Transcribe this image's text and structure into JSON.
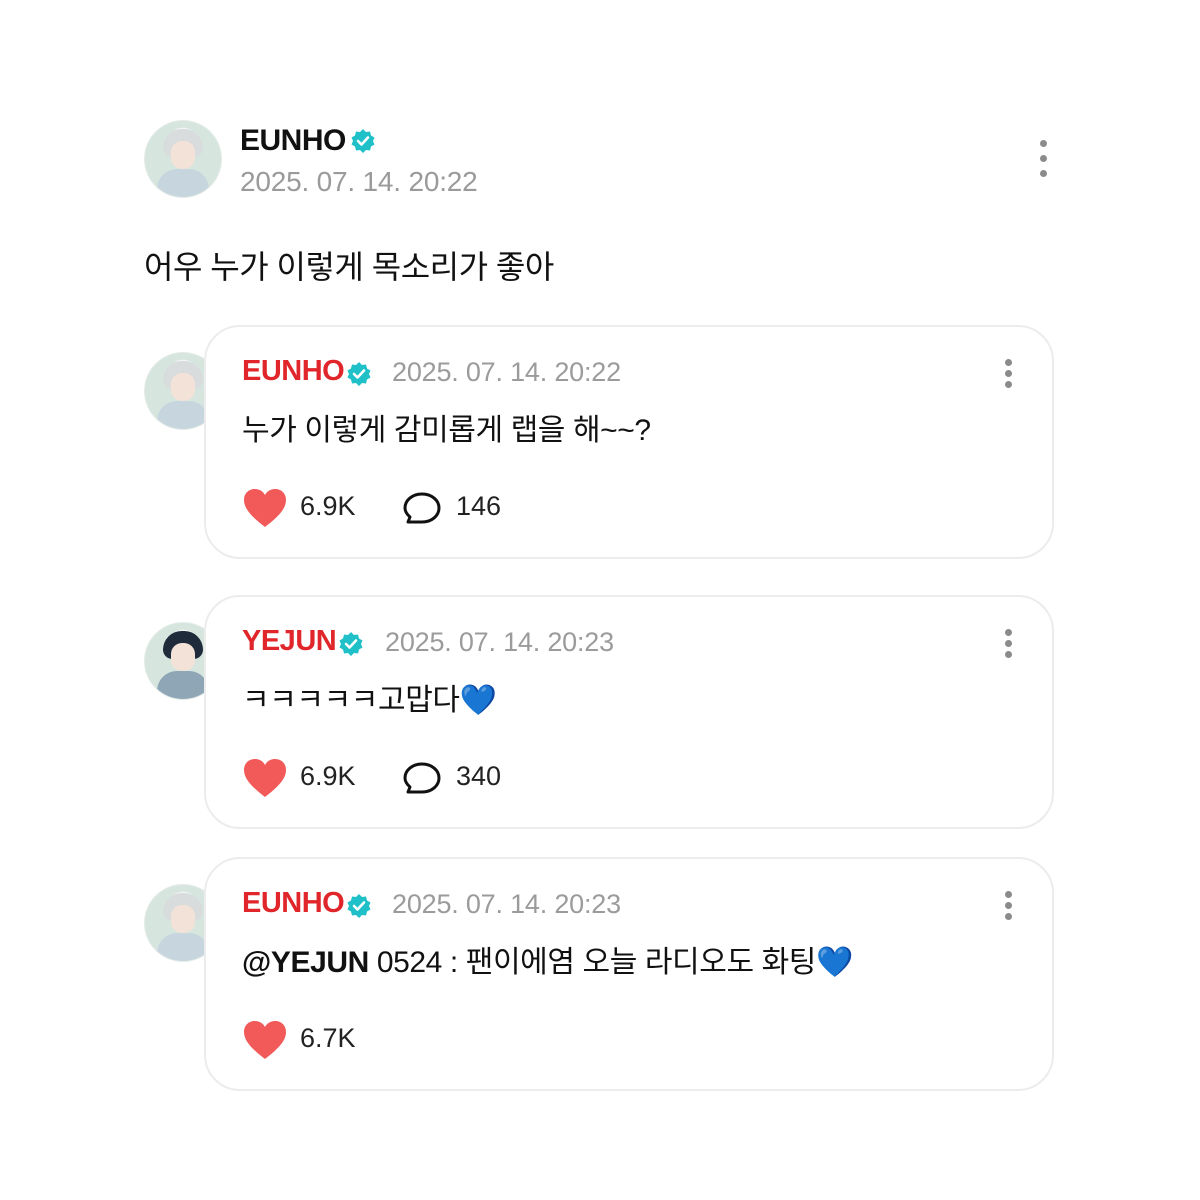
{
  "post": {
    "author": "EUNHO",
    "timestamp": "2025. 07. 14. 20:22",
    "text": "어우 누가 이렇게 목소리가 좋아",
    "verified_icon": "verified-badge-icon",
    "menu_icon": "more-vertical-icon"
  },
  "replies": [
    {
      "author": "EUNHO",
      "timestamp": "2025. 07. 14. 20:22",
      "text": "누가 이렇게 감미롭게 랩을 해~~?",
      "likes": "6.9K",
      "comments": "146"
    },
    {
      "author": "YEJUN",
      "timestamp": "2025. 07. 14. 20:23",
      "text": "ㅋㅋㅋㅋㅋ고맙다",
      "emoji": "💙",
      "likes": "6.9K",
      "comments": "340"
    },
    {
      "author": "EUNHO",
      "timestamp": "2025. 07. 14. 20:23",
      "mention": "@YEJUN",
      "text": " 0524 : 팬이에염 오늘 라디오도 화팅",
      "emoji": "💙",
      "likes": "6.7K"
    }
  ],
  "colors": {
    "reply_name": "#e0262a",
    "verified": "#1fc0c8",
    "like_heart": "#f25a5a",
    "timestamp": "#9a9a9a"
  }
}
